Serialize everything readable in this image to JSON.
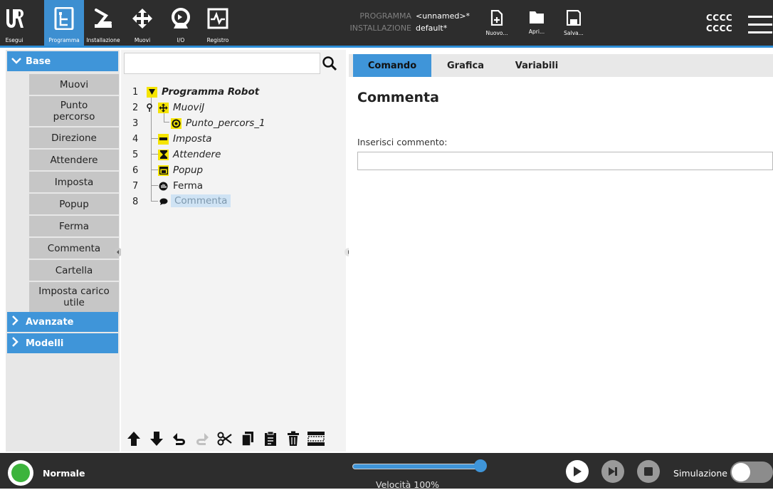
{
  "nav": {
    "items": [
      {
        "label": "Esegui",
        "icon": "ur-logo-icon"
      },
      {
        "label": "Programma",
        "icon": "program-tree-icon"
      },
      {
        "label": "Installazione",
        "icon": "robot-arm-icon"
      },
      {
        "label": "Muovi",
        "icon": "move-arrows-icon"
      },
      {
        "label": "I/O",
        "icon": "io-icon"
      },
      {
        "label": "Registro",
        "icon": "log-icon"
      }
    ],
    "active": "Programma"
  },
  "program_info": {
    "program_key": "PROGRAMMA",
    "program_value": "<unnamed>*",
    "installation_key": "INSTALLAZIONE",
    "installation_value": "default*"
  },
  "file_buttons": {
    "new_label": "Nuovo...",
    "open_label": "Apri...",
    "save_label": "Salva..."
  },
  "user": {
    "line1": "CCCC",
    "line2": "CCCC"
  },
  "library": {
    "base_header": "Base",
    "base_items": [
      "Muovi",
      "Punto percorso",
      "Direzione",
      "Attendere",
      "Imposta",
      "Popup",
      "Ferma",
      "Commenta",
      "Cartella",
      "Imposta carico utile"
    ],
    "advanced_header": "Avanzate",
    "templates_header": "Modelli"
  },
  "tree": {
    "rows": [
      {
        "num": "1",
        "label": "Programma Robot"
      },
      {
        "num": "2",
        "label": "MuoviJ"
      },
      {
        "num": "3",
        "label": "Punto_percors_1"
      },
      {
        "num": "4",
        "label": "Imposta"
      },
      {
        "num": "5",
        "label": "Attendere"
      },
      {
        "num": "6",
        "label": "Popup"
      },
      {
        "num": "7",
        "label": "Ferma"
      },
      {
        "num": "8",
        "label": "Commenta"
      }
    ],
    "selected": "Commenta"
  },
  "tabs": {
    "command": "Comando",
    "graphics": "Grafica",
    "variables": "Variabili",
    "active": "Comando"
  },
  "command": {
    "title": "Commenta",
    "input_label": "Inserisci commento:",
    "input_value": ""
  },
  "status": {
    "mode": "Normale",
    "led_color": "#3cb43c"
  },
  "speed": {
    "label": "Velocità 100%",
    "value": 1.0
  },
  "simulation": {
    "label": "Simulazione",
    "enabled": false
  },
  "colors": {
    "accent": "#3f95d9",
    "topbar": "#2d2d2d",
    "tree_icon_yellow": "#f5e400"
  }
}
